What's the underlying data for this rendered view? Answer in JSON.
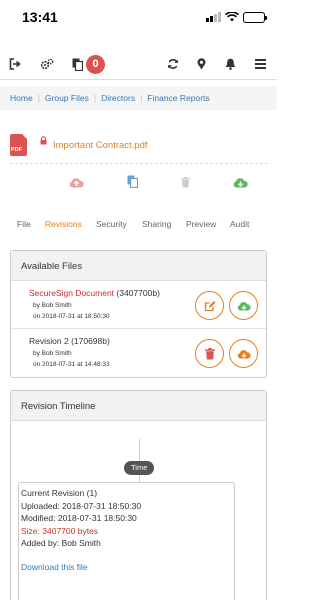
{
  "status_bar": {
    "time": "13:41"
  },
  "toolbar": {
    "badge_count": "0"
  },
  "breadcrumb": [
    "Home",
    "Group Files",
    "Directors",
    "Finance Reports"
  ],
  "file": {
    "name": "Important Contract.pdf",
    "type_label": "PDF"
  },
  "actions": [
    {
      "icon": "cloud-upload-icon",
      "color": "#d9534f"
    },
    {
      "icon": "copy-icon",
      "color": "#337ab7"
    },
    {
      "icon": "trash-icon",
      "color": "#cccccc"
    },
    {
      "icon": "cloud-download-icon",
      "color": "#5cb85c"
    }
  ],
  "tabs": [
    "File",
    "Revisions",
    "Security",
    "Sharing",
    "Preview",
    "Audit"
  ],
  "active_tab": "Revisions",
  "available_files": {
    "title": "Available Files",
    "rows": [
      {
        "name": "SecureSign Document",
        "size": "(3407700b)",
        "by": "by Bob Smith",
        "on": "on 2018-07-31 at 18:50:30",
        "buttons": [
          "edit-icon",
          "cloud-download-icon"
        ]
      },
      {
        "name": "Revision 2",
        "size": "(170698b)",
        "by": "by Bob Smith",
        "on": "on 2018-07-31 at 14:48:33",
        "buttons": [
          "trash-icon",
          "cloud-download-icon"
        ]
      }
    ]
  },
  "timeline": {
    "title": "Revision Timeline",
    "time_label": "Time",
    "card": {
      "current": "Current Revision (1)",
      "uploaded": "Uploaded: 2018-07-31 18:50:30",
      "modified": "Modified: 2018-07-31 18:50:30",
      "size": "Size: 3407700 bytes",
      "added_by": "Added by: Bob Smith",
      "download": "Download this file"
    }
  },
  "colors": {
    "accent": "#e67e22",
    "link": "#337ab7",
    "danger": "#d9534f",
    "success": "#5cb85c"
  }
}
